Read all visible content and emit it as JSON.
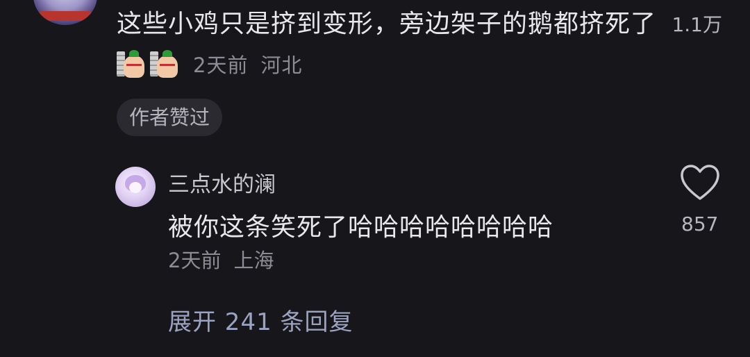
{
  "top_comment": {
    "text": "这些小鸡只是挤到变形，旁边架子的鹅都挤死了",
    "emoji": "wall-peek-emoji",
    "time": "2天前",
    "location": "河北",
    "likes": "1.1万",
    "badge": "作者赞过"
  },
  "reply": {
    "username": "三点水的澜",
    "text": "被你这条笑死了哈哈哈哈哈哈哈哈",
    "time": "2天前",
    "location": "上海",
    "likes": "857"
  },
  "expand_replies": "展开 241 条回复",
  "icons": {
    "like": "heart-outline-icon"
  },
  "colors": {
    "background": "#17161b",
    "primary_text": "#e8e8ec",
    "secondary_text": "#8d8c95",
    "link_text": "#9aa3c2"
  }
}
